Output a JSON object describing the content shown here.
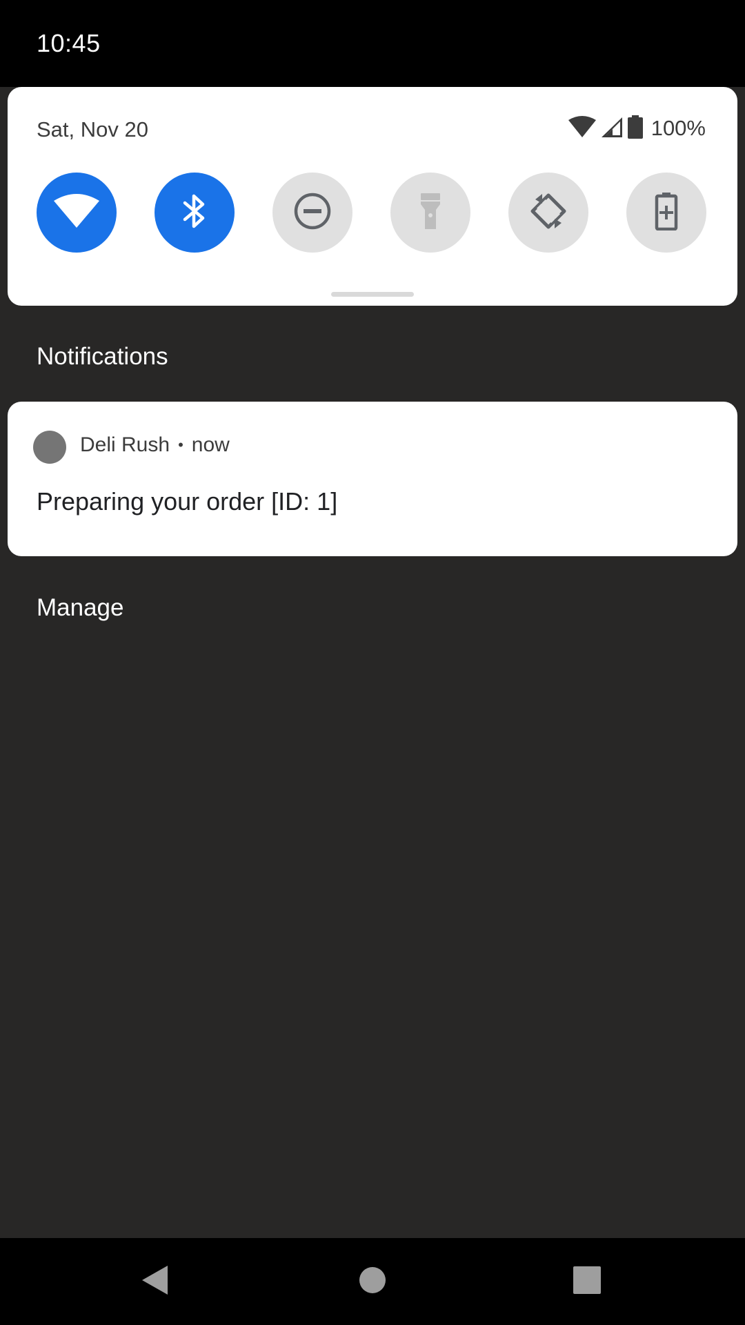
{
  "status_bar": {
    "time": "10:45"
  },
  "quick_settings": {
    "date": "Sat, Nov 20",
    "battery_percent": "100%",
    "status_icons": [
      "wifi-icon",
      "cellular-signal-icon",
      "battery-icon"
    ],
    "tiles": [
      {
        "name": "wifi",
        "icon": "wifi-icon",
        "state": "on"
      },
      {
        "name": "bluetooth",
        "icon": "bluetooth-icon",
        "state": "on"
      },
      {
        "name": "do-not-disturb",
        "icon": "do-not-disturb-icon",
        "state": "off"
      },
      {
        "name": "flashlight",
        "icon": "flashlight-icon",
        "state": "disabled"
      },
      {
        "name": "auto-rotate",
        "icon": "auto-rotate-icon",
        "state": "off"
      },
      {
        "name": "battery-saver",
        "icon": "battery-saver-icon",
        "state": "off"
      }
    ]
  },
  "notifications": {
    "header": "Notifications",
    "items": [
      {
        "app": "Deli Rush",
        "separator": "•",
        "time": "now",
        "text": "Preparing your order [ID: 1]"
      }
    ],
    "manage_label": "Manage"
  },
  "nav_bar": {
    "buttons": [
      "back-icon",
      "home-icon",
      "recents-icon"
    ]
  },
  "colors": {
    "accent": "#1a73e8",
    "tile_off": "#e0e0e0",
    "shade_background": "#282726"
  }
}
